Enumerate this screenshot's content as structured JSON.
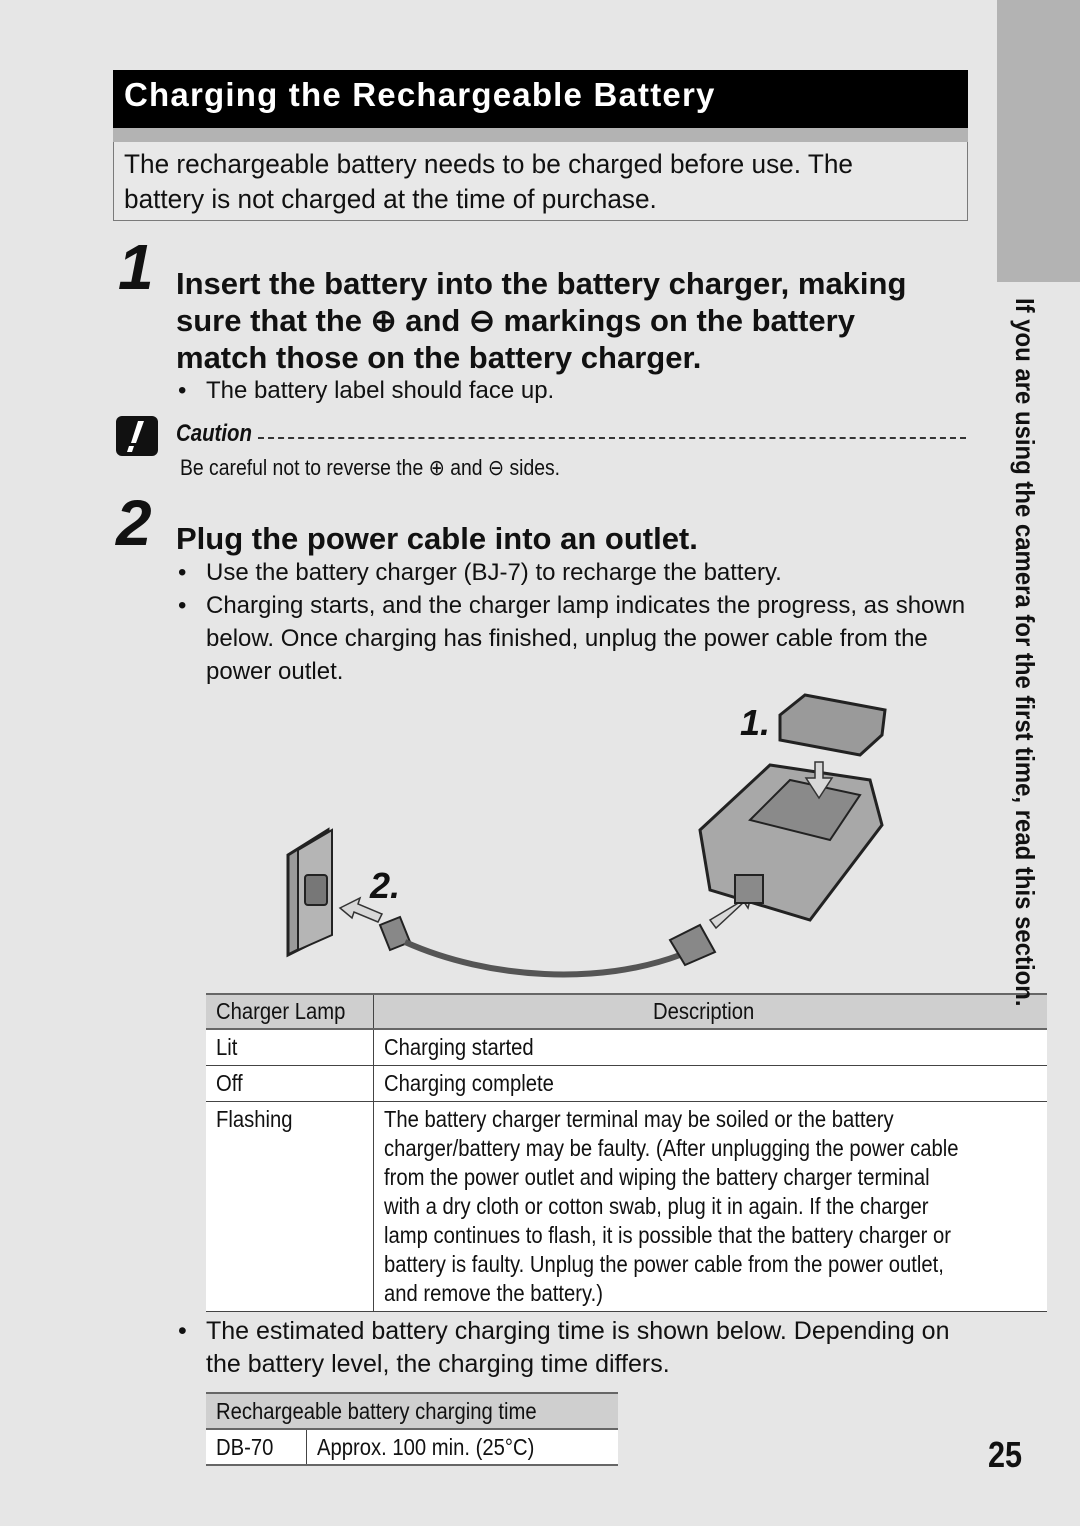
{
  "section": {
    "title": "Charging the Rechargeable Battery",
    "intro": "The rechargeable battery needs to be charged before use. The battery is not charged at the time of purchase."
  },
  "steps": [
    {
      "number": "1",
      "heading_line1": "Insert the battery into the battery charger, making",
      "heading_line2": "sure that the ⊕ and ⊖ markings on the battery",
      "heading_line3": "match those on the battery charger.",
      "bullets": [
        "The battery label should face up."
      ]
    },
    {
      "number": "2",
      "heading_line1": "Plug the power cable into an outlet.",
      "bullets": [
        "Use the battery charger (BJ-7) to recharge the battery.",
        "Charging starts, and the charger lamp indicates the progress, as shown below. Once charging has finished, unplug the power cable from the power outlet."
      ]
    }
  ],
  "caution": {
    "label": "Caution",
    "text": "Be careful not to reverse the ⊕ and ⊖ sides."
  },
  "illustration": {
    "label_1": "1.",
    "label_2": "2."
  },
  "lamp_table": {
    "headers": [
      "Charger Lamp",
      "Description"
    ],
    "rows": [
      {
        "lamp": "Lit",
        "description": "Charging started"
      },
      {
        "lamp": "Off",
        "description": "Charging complete"
      },
      {
        "lamp": "Flashing",
        "description": [
          "The battery charger terminal may be soiled or the battery",
          "charger/battery may be faulty. (After unplugging the power cable",
          "from the power outlet and wiping the battery charger terminal",
          "with a dry cloth or cotton swab, plug it in again. If the charger",
          "lamp continues to flash, it is possible that the battery charger or",
          "battery is faulty. Unplug the power cable from the power outlet,",
          "and remove the battery.)"
        ]
      }
    ]
  },
  "time_note": "The estimated battery charging time is shown below. Depending on the battery level, the charging time differs.",
  "time_table": {
    "header": "Rechargeable battery charging time",
    "rows": [
      {
        "model": "DB-70",
        "time": "Approx. 100 min. (25°C)"
      }
    ]
  },
  "side_tab": "If you are using the camera for the first time, read this section.",
  "page_number": "25"
}
